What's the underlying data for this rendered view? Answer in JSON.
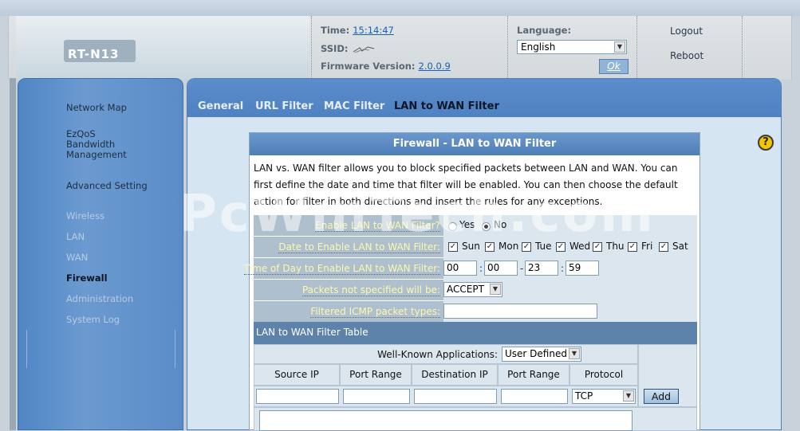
{
  "header": {
    "model": "RT-N13",
    "time_label": "Time:",
    "time_value": "15:14:47",
    "ssid_label": "SSID:",
    "firmware_label": "Firmware Version:",
    "firmware_value": "2.0.0.9",
    "language_label": "Language:",
    "language_selected": "English",
    "ok_label": "Ok",
    "logout_label": "Logout",
    "reboot_label": "Reboot"
  },
  "sidebar": {
    "items": [
      {
        "label": "Network Map"
      },
      {
        "label": "EzQoS\nBandwidth\nManagement"
      },
      {
        "label": "Advanced Setting"
      },
      {
        "label": "Wireless"
      },
      {
        "label": "LAN"
      },
      {
        "label": "WAN"
      },
      {
        "label": "Firewall"
      },
      {
        "label": "Administration"
      },
      {
        "label": "System Log"
      }
    ]
  },
  "tabs": [
    {
      "label": "General"
    },
    {
      "label": "URL Filter"
    },
    {
      "label": "MAC Filter"
    },
    {
      "label": "LAN to WAN Filter"
    }
  ],
  "panel": {
    "title": "Firewall - LAN to WAN Filter",
    "description": "LAN vs. WAN filter allows you to block specified packets between LAN and WAN. You can first define the date and time that filter will be enabled. You can then choose the default action for filter in both directions and insert the rules for any exceptions.",
    "enable_label": "Enable LAN to WAN Filter?",
    "yes_label": "Yes",
    "no_label": "No",
    "date_label": "Date to Enable LAN to WAN Filter:",
    "days": [
      "Sun",
      "Mon",
      "Tue",
      "Wed",
      "Thu",
      "Fri",
      "Sat"
    ],
    "time_label": "Time of Day to Enable LAN to WAN Filter:",
    "time_values": [
      "00",
      "00",
      "23",
      "59"
    ],
    "time_sep_colon": ":",
    "time_sep_dash": "-",
    "packets_label": "Packets not specified will be:",
    "packets_value": "ACCEPT",
    "icmp_label": "Filtered ICMP packet types:",
    "icmp_value": "",
    "table_title": "LAN to WAN Filter Table",
    "wellknown_label": "Well-Known Applications:",
    "wellknown_value": "User Defined",
    "columns": [
      "Source IP",
      "Port Range",
      "Destination IP",
      "Port Range",
      "Protocol"
    ],
    "protocol_value": "TCP",
    "add_label": "Add"
  },
  "watermark": "PcWinTech.com",
  "help_icon": "question-mark-icon"
}
